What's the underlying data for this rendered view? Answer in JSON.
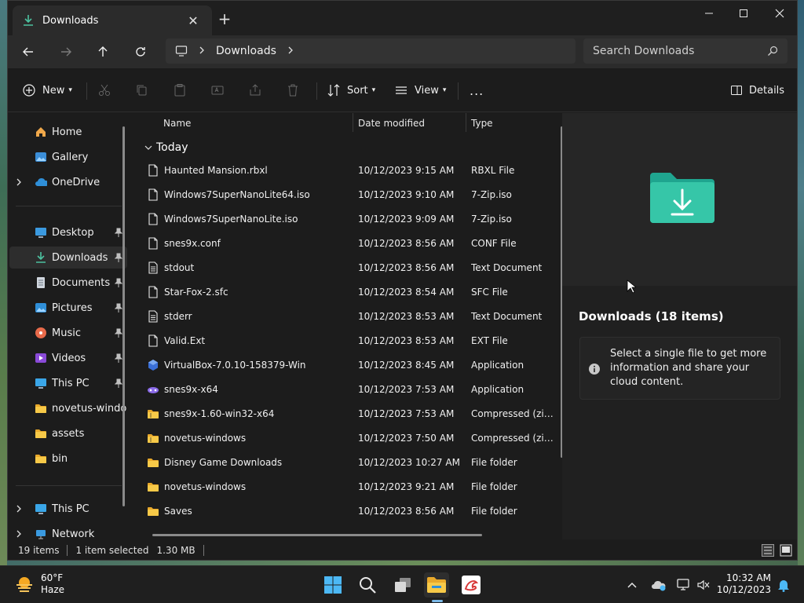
{
  "window": {
    "tab_title": "Downloads",
    "breadcrumb": [
      "Downloads"
    ],
    "search_placeholder": "Search Downloads"
  },
  "toolbar": {
    "new_label": "New",
    "sort_label": "Sort",
    "view_label": "View",
    "more_label": "...",
    "details_label": "Details"
  },
  "sidebar": {
    "items": [
      {
        "label": "Home",
        "icon": "home-icon"
      },
      {
        "label": "Gallery",
        "icon": "gallery-icon"
      },
      {
        "label": "OneDrive",
        "icon": "cloud-icon"
      },
      {
        "label": "Desktop",
        "icon": "desktop-icon",
        "pinned": true
      },
      {
        "label": "Downloads",
        "icon": "download-icon",
        "pinned": true,
        "selected": true
      },
      {
        "label": "Documents",
        "icon": "documents-icon",
        "pinned": true
      },
      {
        "label": "Pictures",
        "icon": "pictures-icon",
        "pinned": true
      },
      {
        "label": "Music",
        "icon": "music-icon",
        "pinned": true
      },
      {
        "label": "Videos",
        "icon": "videos-icon",
        "pinned": true
      },
      {
        "label": "This PC",
        "icon": "pc-icon",
        "pinned": true
      },
      {
        "label": "novetus-windows",
        "icon": "folder-icon"
      },
      {
        "label": "assets",
        "icon": "folder-icon"
      },
      {
        "label": "bin",
        "icon": "folder-icon"
      },
      {
        "label": "This PC",
        "icon": "pc-icon"
      },
      {
        "label": "Network",
        "icon": "network-icon"
      }
    ]
  },
  "columns": {
    "name": "Name",
    "date": "Date modified",
    "type": "Type"
  },
  "group_label": "Today",
  "files": [
    {
      "name": "Haunted Mansion.rbxl",
      "date": "10/12/2023 9:15 AM",
      "type": "RBXL File",
      "icon": "file-icon"
    },
    {
      "name": "Windows7SuperNanoLite64.iso",
      "date": "10/12/2023 9:10 AM",
      "type": "7-Zip.iso",
      "icon": "file-icon"
    },
    {
      "name": "Windows7SuperNanoLite.iso",
      "date": "10/12/2023 9:09 AM",
      "type": "7-Zip.iso",
      "icon": "file-icon"
    },
    {
      "name": "snes9x.conf",
      "date": "10/12/2023 8:56 AM",
      "type": "CONF File",
      "icon": "file-icon"
    },
    {
      "name": "stdout",
      "date": "10/12/2023 8:56 AM",
      "type": "Text Document",
      "icon": "text-file-icon"
    },
    {
      "name": "Star-Fox-2.sfc",
      "date": "10/12/2023 8:54 AM",
      "type": "SFC File",
      "icon": "file-icon"
    },
    {
      "name": "stderr",
      "date": "10/12/2023 8:53 AM",
      "type": "Text Document",
      "icon": "text-file-icon"
    },
    {
      "name": "Valid.Ext",
      "date": "10/12/2023 8:53 AM",
      "type": "EXT File",
      "icon": "file-icon"
    },
    {
      "name": "VirtualBox-7.0.10-158379-Win",
      "date": "10/12/2023 8:45 AM",
      "type": "Application",
      "icon": "virtualbox-icon"
    },
    {
      "name": "snes9x-x64",
      "date": "10/12/2023 7:53 AM",
      "type": "Application",
      "icon": "snes9x-icon"
    },
    {
      "name": "snes9x-1.60-win32-x64",
      "date": "10/12/2023 7:53 AM",
      "type": "Compressed (zipp...",
      "icon": "zip-folder-icon"
    },
    {
      "name": "novetus-windows",
      "date": "10/12/2023 7:50 AM",
      "type": "Compressed (zipp...",
      "icon": "zip-folder-icon"
    },
    {
      "name": "Disney Game Downloads",
      "date": "10/12/2023 10:27 AM",
      "type": "File folder",
      "icon": "folder-icon"
    },
    {
      "name": "novetus-windows",
      "date": "10/12/2023 9:21 AM",
      "type": "File folder",
      "icon": "folder-icon"
    },
    {
      "name": "Saves",
      "date": "10/12/2023 8:56 AM",
      "type": "File folder",
      "icon": "folder-icon"
    }
  ],
  "details_pane": {
    "heading": "Downloads (18 items)",
    "message": "Select a single file to get more information and share your cloud content."
  },
  "status": {
    "count": "19 items",
    "selected": "1 item selected",
    "size": "1.30 MB"
  },
  "taskbar": {
    "temp": "60°F",
    "weather": "Haze",
    "time": "10:32 AM",
    "date": "10/12/2023"
  },
  "colors": {
    "accent": "#4cc2a0",
    "folder": "#f4c35a",
    "selection": "#2d2d2d"
  }
}
